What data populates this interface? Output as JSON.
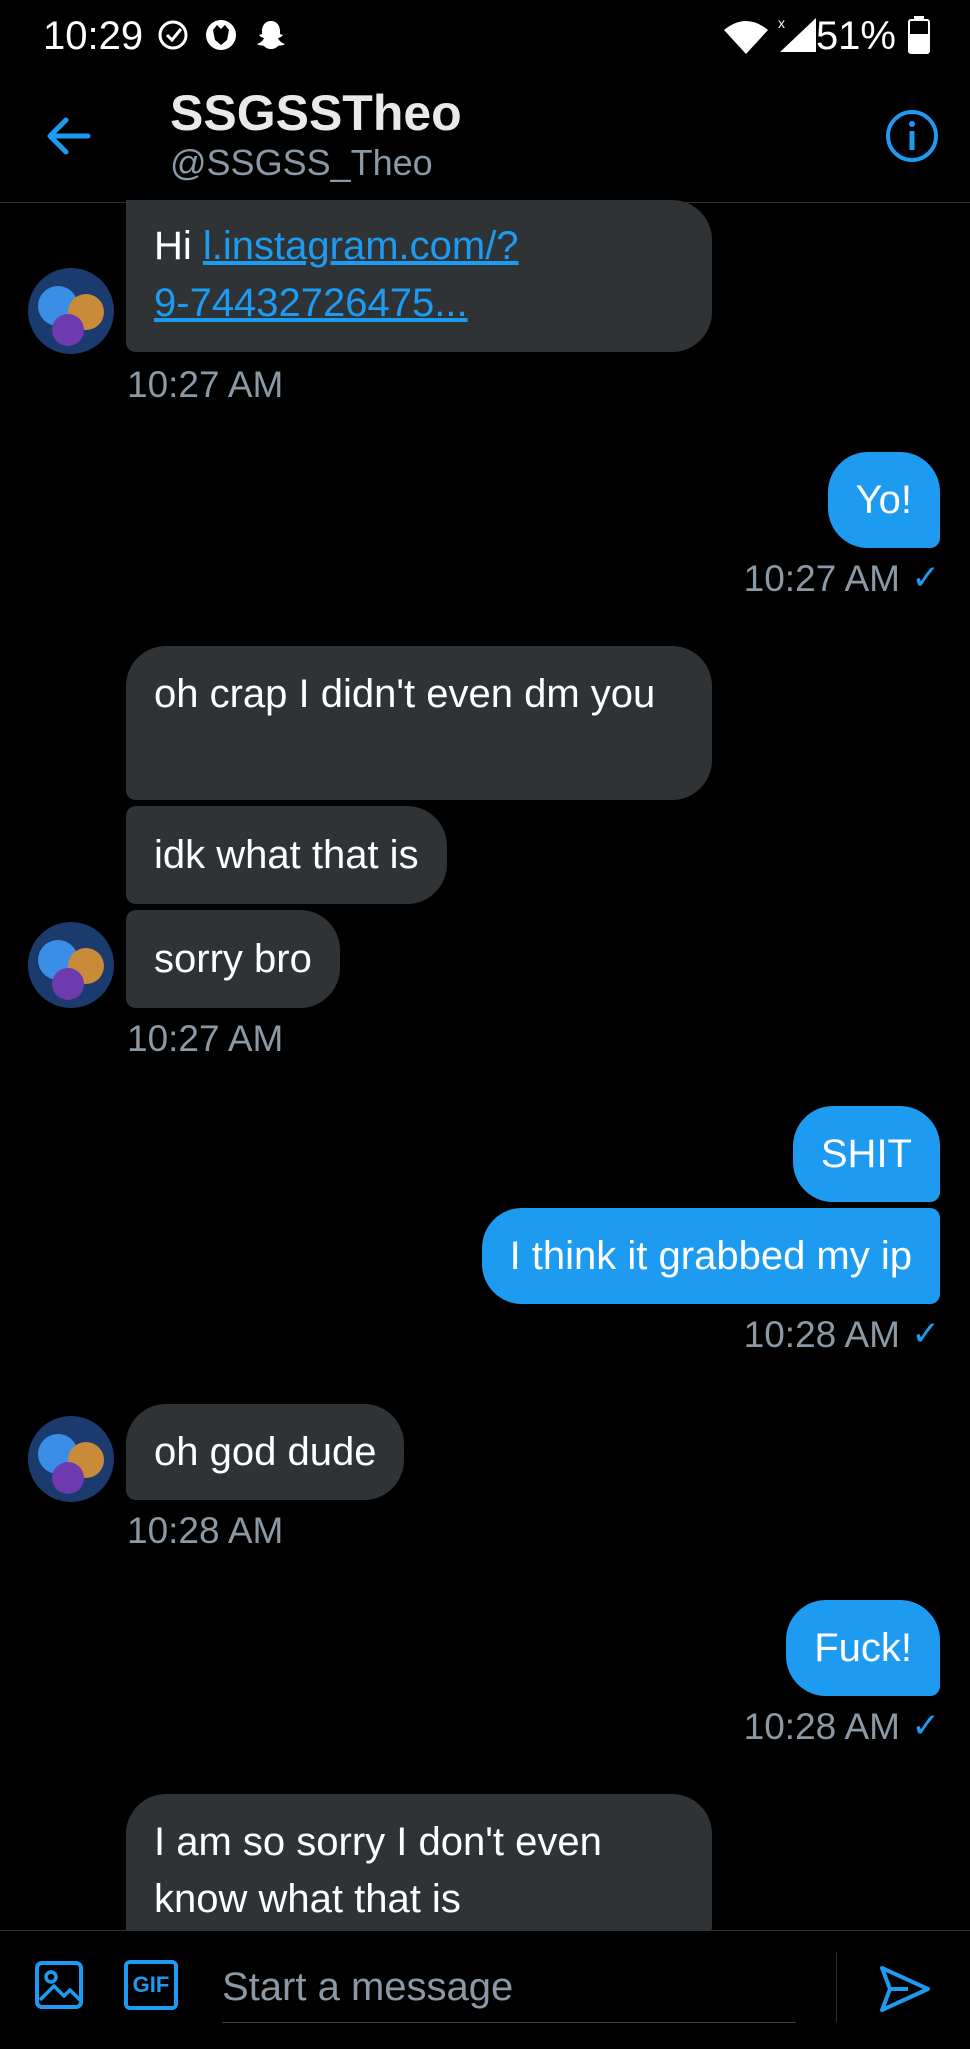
{
  "status_bar": {
    "time": "10:29",
    "battery": "51%",
    "icons": [
      "check-circle-icon",
      "wolf-icon",
      "snapchat-icon",
      "wifi-icon",
      "signal-icon",
      "battery-icon"
    ]
  },
  "header": {
    "title": "SSGSSTheo",
    "handle": "@SSGSS_Theo",
    "accent": "#1d9bf0"
  },
  "messages": {
    "m1_prefix": "Hi ",
    "m1_link_line1": "l.instagram.com/?",
    "m1_link_line2": "9-74432726475...",
    "t1": "10:27 AM",
    "m2": "Yo!",
    "t2": "10:27 AM",
    "m3": "oh crap I didn't even dm you",
    "m4": "idk what that is",
    "m5": "sorry bro",
    "t3": "10:27 AM",
    "m6": "SHIT",
    "m7": "I think it grabbed my ip",
    "t4": "10:28 AM",
    "m8": "oh god dude",
    "t5": "10:28 AM",
    "m9": "Fuck!",
    "t6": "10:28 AM",
    "m10": "I am so sorry I don't even know what that is",
    "check": "✓"
  },
  "composer": {
    "placeholder": "Start a message",
    "gif_label": "GIF"
  }
}
